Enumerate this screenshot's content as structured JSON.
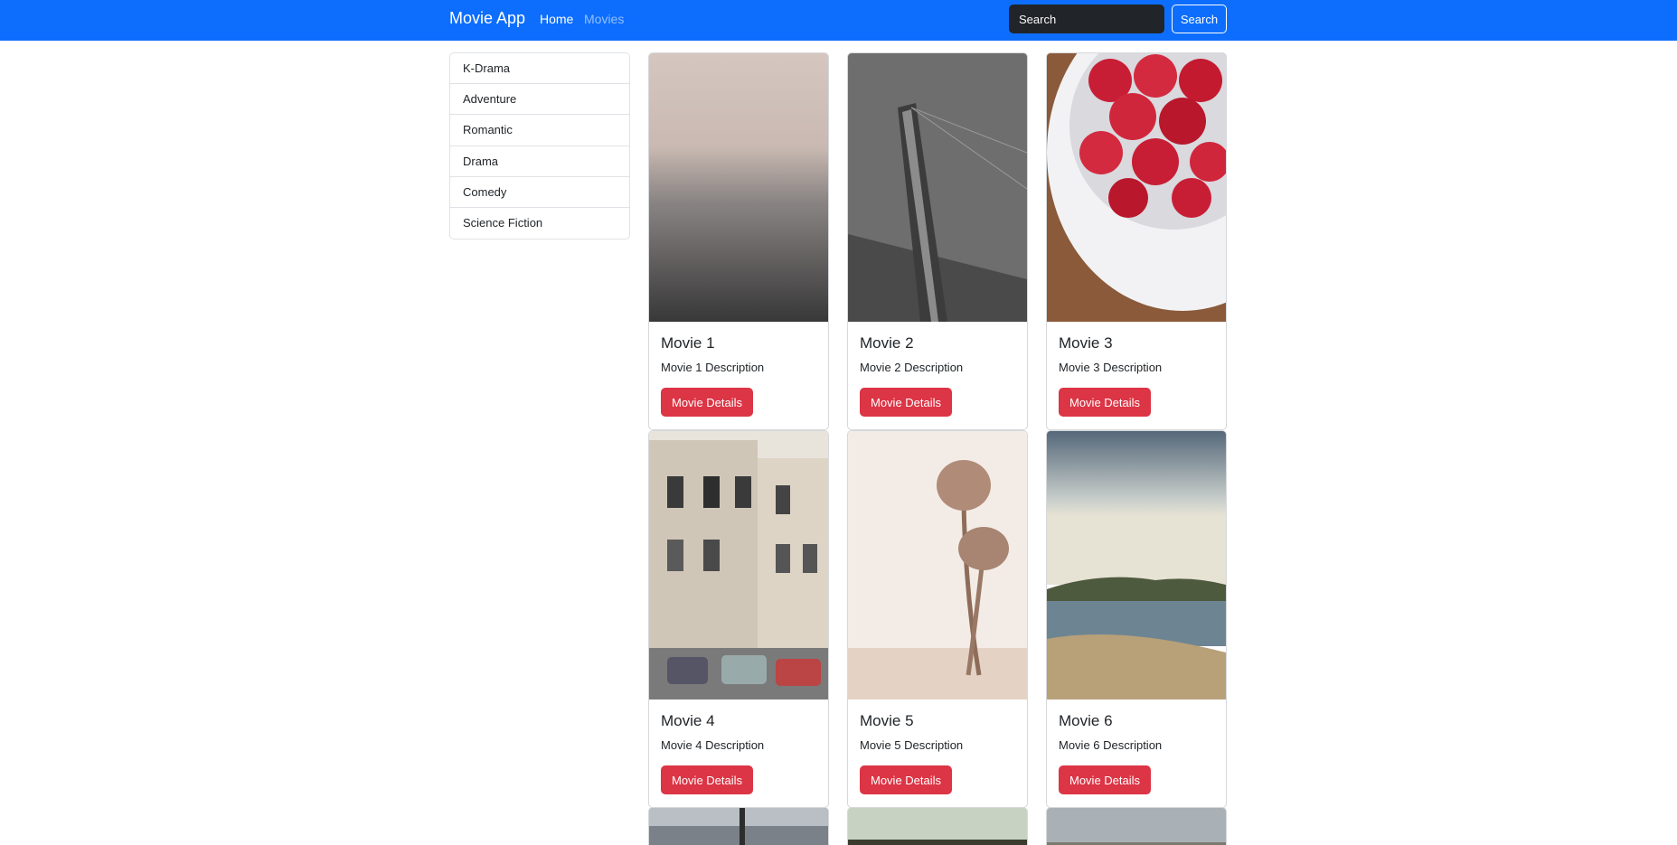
{
  "navbar": {
    "brand": "Movie App",
    "links": [
      "Home",
      "Movies"
    ],
    "search_placeholder": "Search",
    "search_button": "Search"
  },
  "categories": [
    "K-Drama",
    "Adventure",
    "Romantic",
    "Drama",
    "Comedy",
    "Science Fiction"
  ],
  "movies": [
    {
      "title": "Movie 1",
      "description": "Movie 1 Description",
      "button": "Movie Details"
    },
    {
      "title": "Movie 2",
      "description": "Movie 2 Description",
      "button": "Movie Details"
    },
    {
      "title": "Movie 3",
      "description": "Movie 3 Description",
      "button": "Movie Details"
    },
    {
      "title": "Movie 4",
      "description": "Movie 4 Description",
      "button": "Movie Details"
    },
    {
      "title": "Movie 5",
      "description": "Movie 5 Description",
      "button": "Movie Details"
    },
    {
      "title": "Movie 6",
      "description": "Movie 6 Description",
      "button": "Movie Details"
    }
  ],
  "colors": {
    "navbar": "#0d6efd",
    "button": "#dc3545"
  }
}
